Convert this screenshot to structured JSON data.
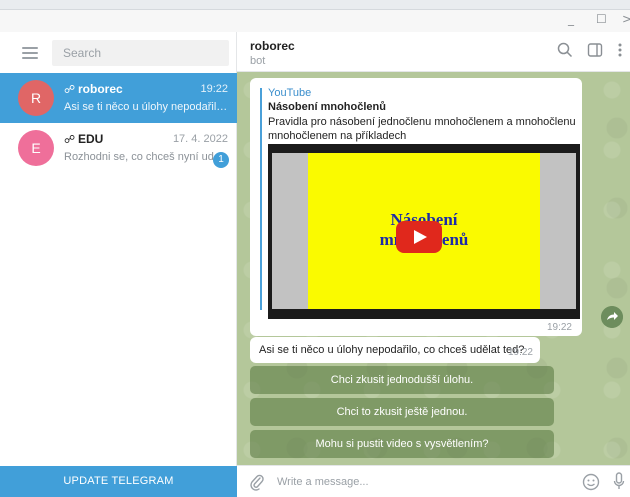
{
  "window": {
    "controls": [
      "_",
      "☐",
      ">"
    ]
  },
  "sidebar": {
    "search_placeholder": "Search",
    "chats": [
      {
        "name": "roborec",
        "time": "19:22",
        "preview": "Asi se ti něco u úlohy nepodařilo, co chceš udělat ted?",
        "avatar_letter": "R",
        "avatar_color": "#e06666",
        "active": true
      },
      {
        "name": "EDU",
        "time": "17. 4. 2022",
        "preview": "Rozhodni se, co chceš nyní udělat.",
        "avatar_letter": "E",
        "avatar_color": "#ef6f9a",
        "badge": "1",
        "active": false
      }
    ],
    "update_label": "UPDATE TELEGRAM"
  },
  "header": {
    "title": "roborec",
    "subtitle": "bot"
  },
  "messages": {
    "card": {
      "site": "YouTube",
      "title": "Násobení mnohočlenů",
      "description": "Pravidla pro násobení jednočlenu mnohočlenem a mnohočlenu mnohočlenem na příkladech",
      "thumb_line1": "Násobení",
      "thumb_line2": "mnohočlenů",
      "time": "19:22"
    },
    "text": {
      "body": "Asi se ti něco u úlohy nepodařilo, co chceš udělat ted?",
      "time": "19:22"
    },
    "buttons": [
      "Chci zkusit jednodušší úlohu.",
      "Chci to zkusit ještě jednou.",
      "Mohu si pustit video s vysvětlením?"
    ]
  },
  "compose": {
    "placeholder": "Write a message..."
  },
  "colors": {
    "accent": "#419fd9",
    "chat_bg": "#b4c79a",
    "link": "#3a8ecc"
  }
}
